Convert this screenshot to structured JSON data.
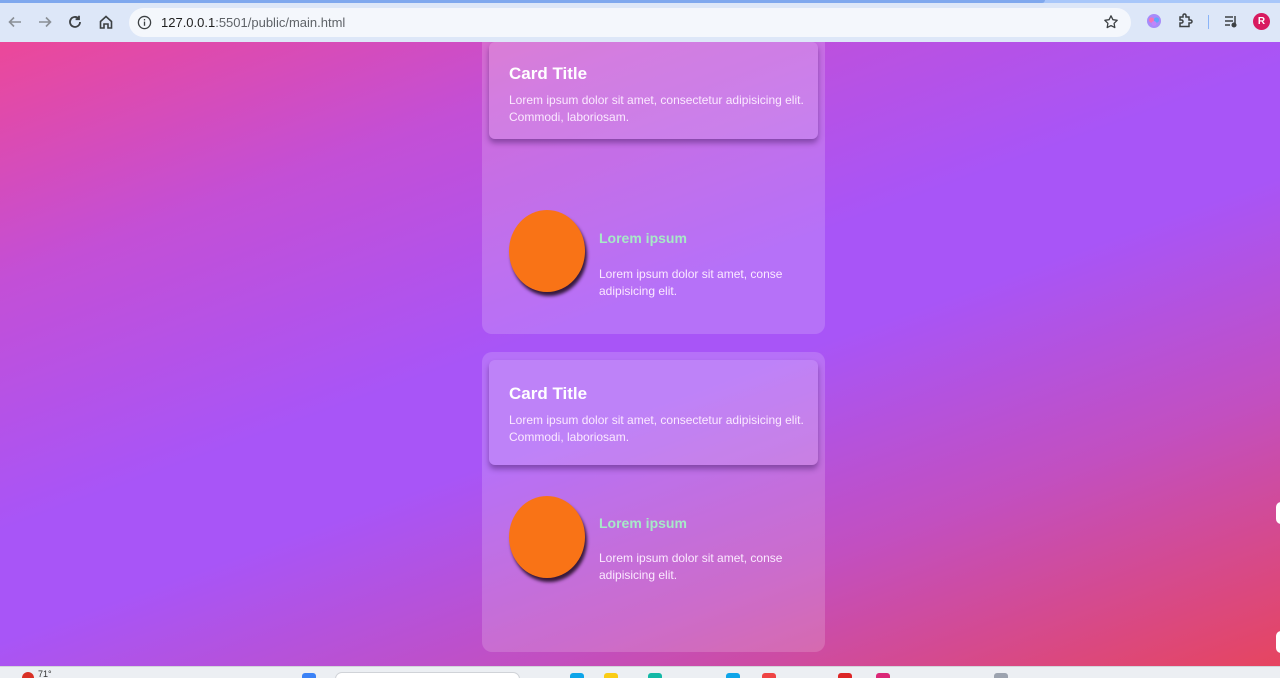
{
  "browser": {
    "url_host": "127.0.0.1",
    "url_rest": ":5501/public/main.html",
    "profile_initial": "R",
    "icons": [
      "back-icon",
      "forward-icon",
      "reload-icon",
      "home-icon",
      "site-info-icon",
      "bookmark-star-icon",
      "extension-brain-icon",
      "extensions-puzzle-icon",
      "media-controls-icon"
    ]
  },
  "cards": [
    {
      "title": "Card Title",
      "text": "Lorem ipsum dolor sit amet, consectetur adipisicing elit. Commodi, laboriosam.",
      "media_title": "Lorem ipsum",
      "media_text": "Lorem ipsum dolor sit amet, conse adipisicing elit."
    },
    {
      "title": "Card Title",
      "text": "Lorem ipsum dolor sit amet, consectetur adipisicing elit. Commodi, laboriosam.",
      "media_title": "Lorem ipsum",
      "media_text": "Lorem ipsum dolor sit amet, conse adipisicing elit."
    }
  ],
  "colors": {
    "gradient_start": "#ec4899",
    "gradient_mid": "#a855f7",
    "gradient_end": "#e64560",
    "circle": "#f97316",
    "media_title": "#a7e9c7"
  },
  "taskbar": {
    "temperature": "71°"
  }
}
